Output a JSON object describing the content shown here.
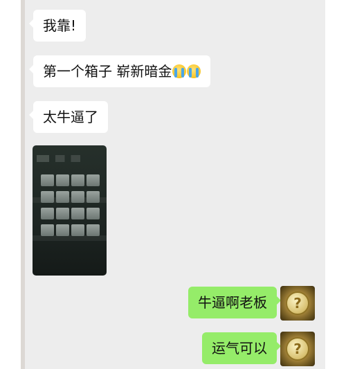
{
  "messages": {
    "received": [
      {
        "text": "我靠!"
      },
      {
        "text": "第一个箱子 崭新暗金"
      },
      {
        "text": "太牛逼了"
      }
    ],
    "sent": [
      {
        "text": "牛逼啊老板"
      },
      {
        "text": "运气可以"
      }
    ]
  },
  "emoji": {
    "name": "crying-face-icon",
    "count": 2
  },
  "media": {
    "type": "video-thumbnail",
    "icon": "inventory-screenshot"
  },
  "avatar": {
    "icon": "question-coin-icon",
    "glyph": "?"
  },
  "colors": {
    "chat_bg": "#ededed",
    "sent_bubble": "#95ec69",
    "received_bubble": "#ffffff"
  }
}
